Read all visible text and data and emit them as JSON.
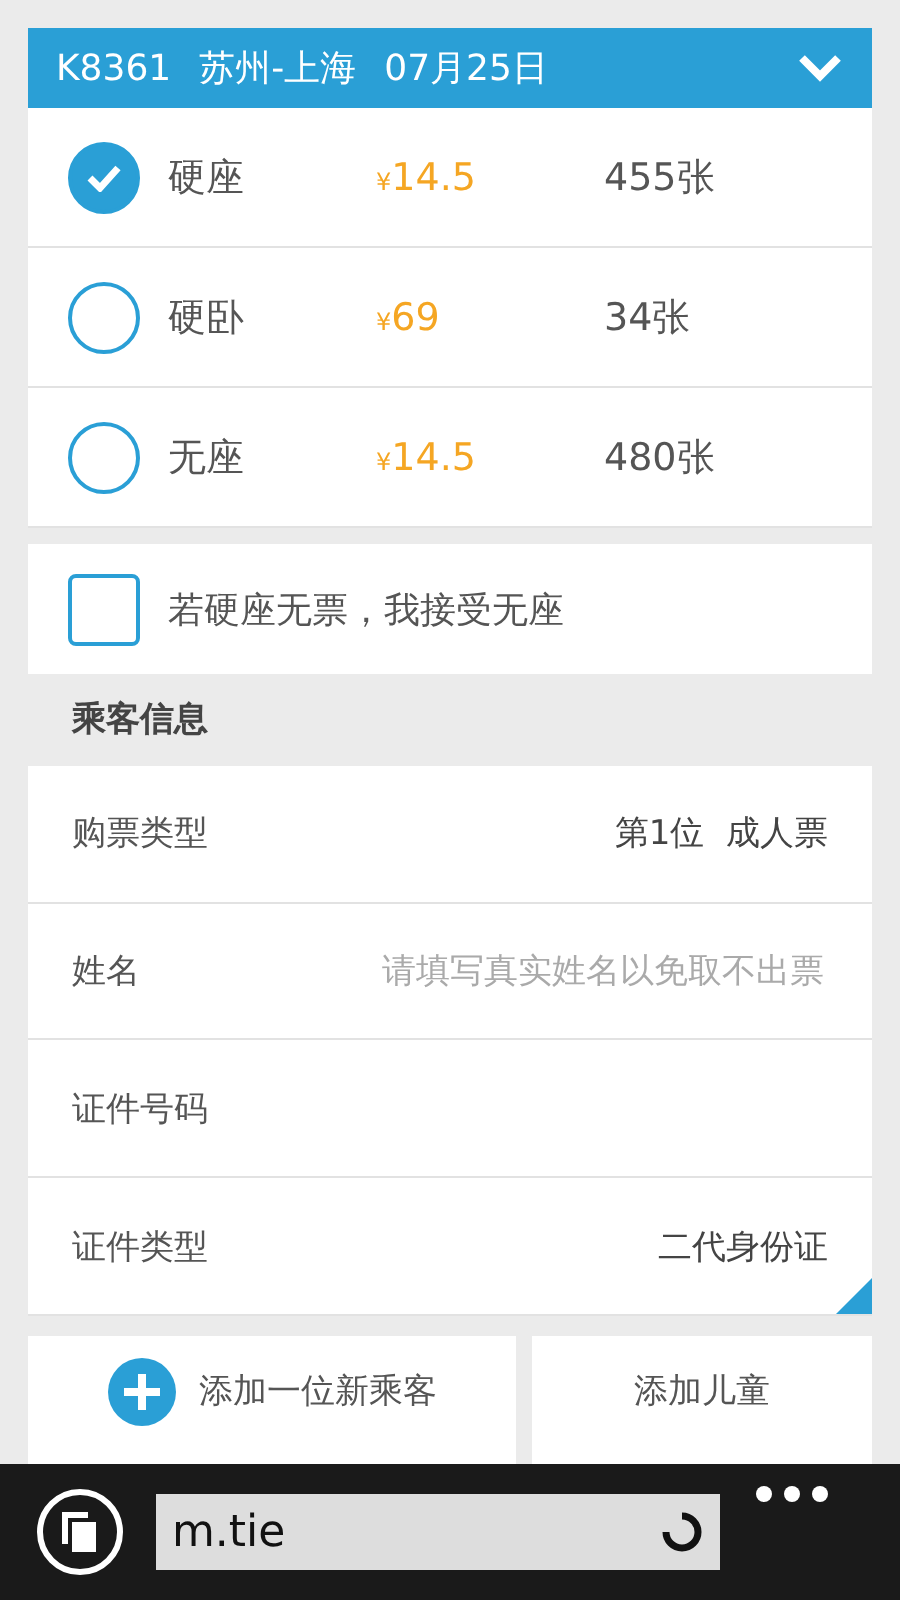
{
  "header": {
    "train": "K8361",
    "route": "苏州-上海",
    "date": "07月25日",
    "expanded": true
  },
  "seats": [
    {
      "name": "硬座",
      "currency": "¥",
      "price": "14.5",
      "count": "455张",
      "selected": true
    },
    {
      "name": "硬卧",
      "currency": "¥",
      "price": "69",
      "count": "34张",
      "selected": false
    },
    {
      "name": "无座",
      "currency": "¥",
      "price": "14.5",
      "count": "480张",
      "selected": false
    }
  ],
  "accept_no_seat": {
    "label": "若硬座无票，我接受无座",
    "checked": false
  },
  "section_title": "乘客信息",
  "fields": [
    {
      "label": "购票类型",
      "value": "第1位  成人票"
    },
    {
      "label": "姓名",
      "placeholder": "请填写真实姓名以免取不出票"
    },
    {
      "label": "证件号码"
    },
    {
      "label": "证件类型",
      "value": "二代身份证",
      "dropdown": true
    }
  ],
  "actions": [
    {
      "kind": "add",
      "label": "添加一位新乘客"
    },
    {
      "kind": "plain",
      "label": "添加儿童"
    }
  ],
  "browser_bar": {
    "url": "m.tie"
  }
}
